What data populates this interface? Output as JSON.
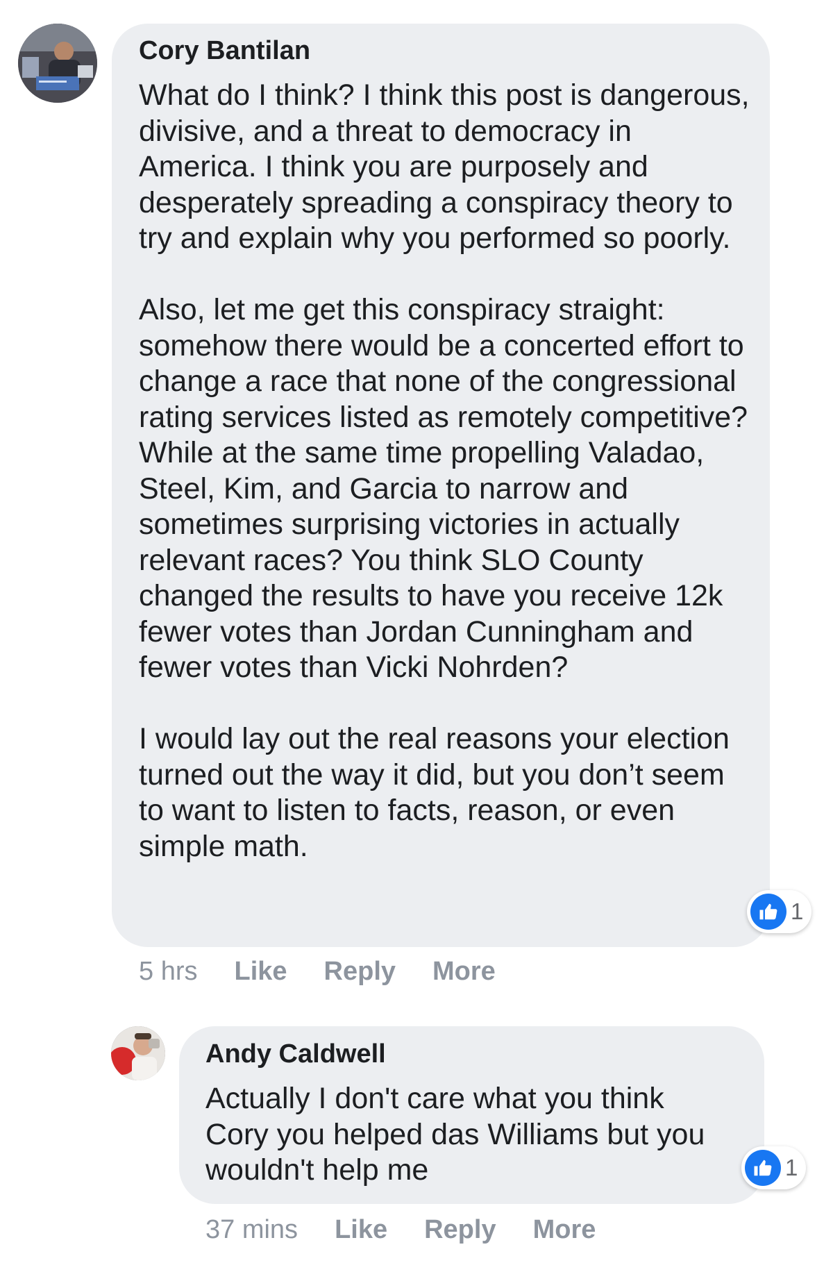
{
  "comments": [
    {
      "author": "Cory Bantilan",
      "paragraphs": [
        "What do I think? I think this post is dangerous, divisive, and a threat to democracy in America. I think you are purposely and desperately spreading a conspiracy theory to try and explain why you performed so poorly.",
        "Also, let me get this conspiracy straight: somehow there would be a concerted effort to change a race that none of the congressional rating services listed as remotely competitive? While at the same time propelling Valadao, Steel, Kim, and Garcia to narrow and sometimes surprising victories in actually relevant races? You think SLO County changed the results to have you receive 12k fewer votes than Jordan Cunningham and fewer votes than Vicki Nohrden?",
        "I would lay out the real reasons your election turned out the way it did, but you don’t seem to want to listen to facts, reason, or even simple math."
      ],
      "time": "5 hrs",
      "like_label": "Like",
      "reply_label": "Reply",
      "more_label": "More",
      "reaction_icon": "like-thumb-icon",
      "reaction_count": "1"
    },
    {
      "author": "Andy Caldwell",
      "paragraphs": [
        "Actually I don't care what you think Cory you helped das Williams but you wouldn't help me"
      ],
      "time": "37 mins",
      "like_label": "Like",
      "reply_label": "Reply",
      "more_label": "More",
      "reaction_icon": "like-thumb-icon",
      "reaction_count": "1"
    }
  ],
  "colors": {
    "bubble": "#eceef1",
    "meta_text": "#8d949e",
    "like_blue": "#1877f2"
  }
}
